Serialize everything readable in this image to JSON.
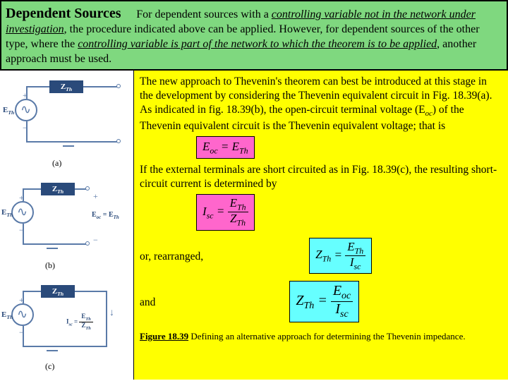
{
  "header": {
    "title": "Dependent Sources",
    "lead1": "For dependent sources with a ",
    "lead_it1": "controlling variable not in the network under investigation",
    "lead2": ", the procedure indicated above can be applied. However, for dependent sources of the other type, where the ",
    "lead_it2": "controlling variable is part of the network to which the theorem is to be applied",
    "lead3": ", another approach must be used."
  },
  "body": {
    "p1a": "The new approach to Thevenin's theorem can best be introduced at this stage in the development by considering the Thevenin equivalent circuit in Fig. 18.39(a). As indicated in fig. 18.39(b), the open-circuit terminal voltage (E",
    "p1b": ") of the Thevenin equivalent circuit is the Thevenin equivalent voltage; that is",
    "eq1": "E_oc = E_Th",
    "p2": "If the external terminals are short circuited as in Fig. 18.39(c), the resulting short-circuit current is determined by",
    "eq2": {
      "lhs": "I_sc",
      "num": "E_Th",
      "den": "Z_Th"
    },
    "p3": "or, rearranged,",
    "eq3": {
      "lhs": "Z_Th",
      "num": "E_Th",
      "den": "I_sc"
    },
    "p4": "and",
    "eq4": {
      "lhs": "Z_Th",
      "num": "E_oc",
      "den": "I_sc"
    },
    "caption_b": "Figure 18.39",
    "caption_t": "  Defining an alternative approach for determining the Thevenin impedance."
  },
  "fig": {
    "z": "Z_Th",
    "e": "E_Th",
    "eoc": "E_oc = E_Th",
    "isc": "I_sc = E_Th / Z_Th",
    "a": "(a)",
    "b": "(b)",
    "c": "(c)"
  }
}
